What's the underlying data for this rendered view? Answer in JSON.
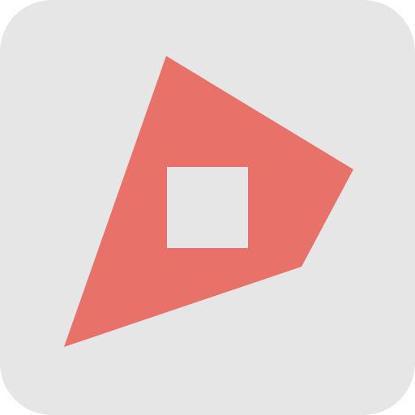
{
  "icon": {
    "name": "kite-logo-icon",
    "colors": {
      "tile_background": "#E6E6E6",
      "kite_fill": "#E8726A",
      "center_square": "#E6E6E6"
    }
  }
}
